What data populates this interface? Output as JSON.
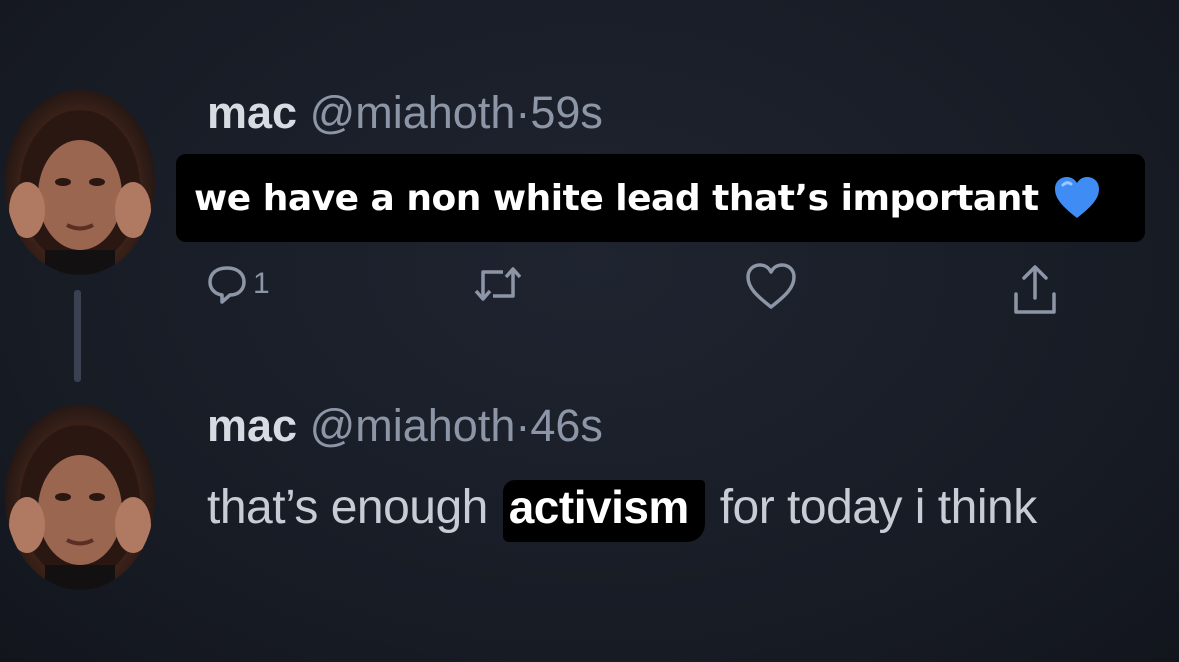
{
  "tweets": [
    {
      "name": "mac",
      "handle": "@miahoth",
      "separator": "·",
      "time": "59s",
      "caption": "we have a non white lead that’s important",
      "caption_emoji": "blue-heart-icon",
      "actions": {
        "reply_count": "1",
        "icons": [
          "reply-icon",
          "retweet-icon",
          "like-icon",
          "share-icon"
        ]
      }
    },
    {
      "name": "mac",
      "handle": "@miahoth",
      "separator": "·",
      "time": "46s",
      "text_before": "that’s enough",
      "text_highlight": "activism",
      "text_after": "for today i think"
    }
  ],
  "colors": {
    "background": "#1a1e28",
    "name": "#d7dbe2",
    "muted": "#8d96a6",
    "caption_bg": "#000000",
    "heart": "#3f8cf5"
  }
}
